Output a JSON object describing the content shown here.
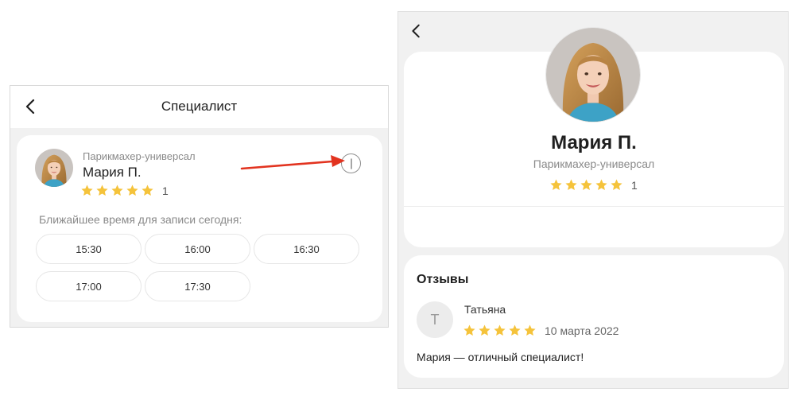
{
  "left": {
    "title": "Специалист",
    "specialist": {
      "role": "Парикмахер-универсал",
      "name": "Мария П.",
      "rating_count": "1"
    },
    "slots_label": "Ближайшее время для записи сегодня:",
    "slots": [
      "15:30",
      "16:00",
      "16:30",
      "17:00",
      "17:30"
    ]
  },
  "right": {
    "profile": {
      "name": "Мария П.",
      "role": "Парикмахер-универсал",
      "rating_count": "1"
    },
    "reviews": {
      "title": "Отзывы",
      "items": [
        {
          "avatar_letter": "Т",
          "author": "Татьяна",
          "date": "10 марта 2022",
          "text": "Мария — отличный специалист!"
        }
      ]
    }
  },
  "colors": {
    "star": "#f5c33b",
    "annotation_arrow": "#e2331f"
  },
  "icons": {
    "back": "chevron-left-icon",
    "info": "info-icon",
    "star": "star-icon"
  }
}
